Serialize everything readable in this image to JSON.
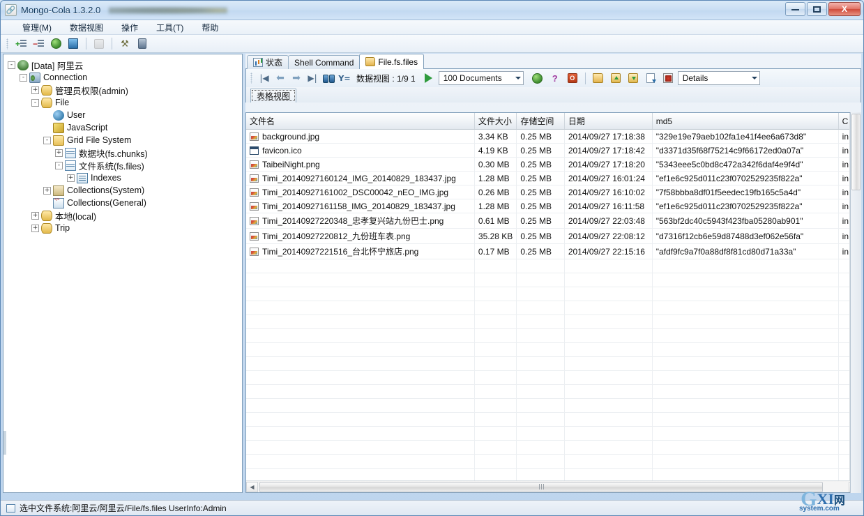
{
  "window": {
    "title": "Mongo-Cola  1.3.2.0",
    "app_icon": "link-icon",
    "minimize_label": "Minimize",
    "maximize_label": "Maximize",
    "close_label": "X"
  },
  "menubar": {
    "items": [
      {
        "label": "管理(M)",
        "name": "menu-manage"
      },
      {
        "label": "数据视图",
        "name": "menu-dataview"
      },
      {
        "label": "操作",
        "name": "menu-operation"
      },
      {
        "label": "工具(T)",
        "name": "menu-tools"
      },
      {
        "label": "帮助",
        "name": "menu-help"
      }
    ]
  },
  "toolbar": {
    "buttons": [
      {
        "name": "add-connection-button",
        "icon": "add-list-icon"
      },
      {
        "name": "remove-connection-button",
        "icon": "remove-list-icon"
      },
      {
        "name": "refresh-button",
        "icon": "globe-icon"
      },
      {
        "name": "database-button",
        "icon": "blue-book-icon"
      },
      {
        "name": "stop-button",
        "icon": "grey-square-icon"
      },
      {
        "name": "options-button",
        "icon": "tools-icon"
      },
      {
        "name": "server-button",
        "icon": "pillar-icon"
      }
    ]
  },
  "tree": {
    "nodes": [
      {
        "label": "[Data] 阿里云",
        "level": 0,
        "expander": "-",
        "icon": "server-icon",
        "name": "tree-node-data-aliyun"
      },
      {
        "label": "Connection",
        "level": 1,
        "expander": "-",
        "icon": "connection-icon",
        "name": "tree-node-connection"
      },
      {
        "label": "管理员权限(admin)",
        "level": 2,
        "expander": "+",
        "icon": "database-icon",
        "name": "tree-node-admin"
      },
      {
        "label": "File",
        "level": 2,
        "expander": "-",
        "icon": "database-icon",
        "name": "tree-node-file"
      },
      {
        "label": "User",
        "level": 3,
        "expander": "",
        "icon": "user-icon",
        "name": "tree-node-user"
      },
      {
        "label": "JavaScript",
        "level": 3,
        "expander": "",
        "icon": "javascript-icon",
        "name": "tree-node-javascript"
      },
      {
        "label": "Grid File System",
        "level": 3,
        "expander": "-",
        "icon": "folder-icon",
        "name": "tree-node-grid-file-system"
      },
      {
        "label": "数据块(fs.chunks)",
        "level": 4,
        "expander": "+",
        "icon": "table-icon",
        "name": "tree-node-fs-chunks"
      },
      {
        "label": "文件系统(fs.files)",
        "level": 4,
        "expander": "-",
        "icon": "table-icon",
        "name": "tree-node-fs-files"
      },
      {
        "label": "Indexes",
        "level": 5,
        "expander": "+",
        "icon": "index-icon",
        "name": "tree-node-indexes"
      },
      {
        "label": "Collections(System)",
        "level": 3,
        "expander": "+",
        "icon": "collections-system-icon",
        "name": "tree-node-collections-system"
      },
      {
        "label": "Collections(General)",
        "level": 3,
        "expander": "",
        "icon": "collections-general-icon",
        "name": "tree-node-collections-general"
      },
      {
        "label": "本地(local)",
        "level": 2,
        "expander": "+",
        "icon": "database-icon",
        "name": "tree-node-local"
      },
      {
        "label": "Trip",
        "level": 2,
        "expander": "+",
        "icon": "database-icon",
        "name": "tree-node-trip"
      }
    ]
  },
  "tabs": [
    {
      "label": "状态",
      "icon": "chart-icon",
      "active": false,
      "name": "tab-status"
    },
    {
      "label": "Shell Command",
      "icon": "",
      "active": false,
      "name": "tab-shell-command"
    },
    {
      "label": "File.fs.files",
      "icon": "open-folder-icon",
      "active": true,
      "name": "tab-file-fs-files"
    }
  ],
  "data_toolbar": {
    "first_label": "|◀",
    "prev_label": "⬅",
    "next_label": "➡",
    "last_label": "▶|",
    "find_label": "find-icon",
    "filter_label": "Y=",
    "dataview_label": "数据视图 : 1/9  1",
    "run_label": "run-icon",
    "limit_value": "100  Documents",
    "web_icon": "globe-icon",
    "help_icon": "?",
    "stop_icon": "O",
    "open_icon": "open-folder-icon",
    "upload_icon": "upload-icon",
    "download_icon": "download-icon",
    "newfile_icon": "new-file-icon",
    "report_icon": "report-icon",
    "view_mode_value": "Details"
  },
  "view_tab": {
    "label": "表格视图",
    "name": "tab-table-view"
  },
  "grid": {
    "columns": [
      {
        "key": "name",
        "label": "文件名"
      },
      {
        "key": "size",
        "label": "文件大小"
      },
      {
        "key": "store",
        "label": "存储空间"
      },
      {
        "key": "date",
        "label": "日期"
      },
      {
        "key": "md5",
        "label": "md5"
      },
      {
        "key": "c",
        "label": "C"
      }
    ],
    "rows": [
      {
        "icon": "image-file-icon",
        "name": "background.jpg",
        "size": "3.34 KB",
        "store": "0.25 MB",
        "date": "2014/09/27 17:18:38",
        "md5": "\"329e19e79aeb102fa1e41f4ee6a673d8\"",
        "c": "in"
      },
      {
        "icon": "ico-file-icon",
        "name": "favicon.ico",
        "size": "4.19 KB",
        "store": "0.25 MB",
        "date": "2014/09/27 17:18:42",
        "md5": "\"d3371d35f68f75214c9f66172ed0a07a\"",
        "c": "in"
      },
      {
        "icon": "image-file-icon",
        "name": "TaibeiNight.png",
        "size": "0.30 MB",
        "store": "0.25 MB",
        "date": "2014/09/27 17:18:20",
        "md5": "\"5343eee5c0bd8c472a342f6daf4e9f4d\"",
        "c": "in"
      },
      {
        "icon": "image-file-icon",
        "name": "Timi_20140927160124_IMG_20140829_183437.jpg",
        "size": "1.28 MB",
        "store": "0.25 MB",
        "date": "2014/09/27 16:01:24",
        "md5": "\"ef1e6c925d011c23f0702529235f822a\"",
        "c": "in"
      },
      {
        "icon": "image-file-icon",
        "name": "Timi_20140927161002_DSC00042_nEO_IMG.jpg",
        "size": "0.26 MB",
        "store": "0.25 MB",
        "date": "2014/09/27 16:10:02",
        "md5": "\"7f58bbba8df01f5eedec19fb165c5a4d\"",
        "c": "in"
      },
      {
        "icon": "image-file-icon",
        "name": "Timi_20140927161158_IMG_20140829_183437.jpg",
        "size": "1.28 MB",
        "store": "0.25 MB",
        "date": "2014/09/27 16:11:58",
        "md5": "\"ef1e6c925d011c23f0702529235f822a\"",
        "c": "in"
      },
      {
        "icon": "image-file-icon",
        "name": "Timi_20140927220348_忠孝复兴站九份巴士.png",
        "size": "0.61 MB",
        "store": "0.25 MB",
        "date": "2014/09/27 22:03:48",
        "md5": "\"563bf2dc40c5943f423fba05280ab901\"",
        "c": "in"
      },
      {
        "icon": "image-file-icon",
        "name": "Timi_20140927220812_九份班车表.png",
        "size": "35.28 KB",
        "store": "0.25 MB",
        "date": "2014/09/27 22:08:12",
        "md5": "\"d7316f12cb6e59d87488d3ef062e56fa\"",
        "c": "in"
      },
      {
        "icon": "image-file-icon",
        "name": "Timi_20140927221516_台北怀宁旅店.png",
        "size": "0.17 MB",
        "store": "0.25 MB",
        "date": "2014/09/27 22:15:16",
        "md5": "\"afdf9fc9a7f0a88df8f81cd80d71a33a\"",
        "c": "in"
      }
    ],
    "empty_row_count": 16
  },
  "statusbar": {
    "icon": "table-icon",
    "text": "选中文件系统:阿里云/阿里云/File/fs.files   UserInfo:Admin"
  },
  "watermark": {
    "g": "G",
    "xi": "XI",
    "net": "网",
    "sub": "system.com"
  },
  "colors": {
    "accent": "#2f6fae",
    "close_button": "#cf4a3a",
    "window_border": "#5b87b5",
    "grid_border": "#7f9db9"
  }
}
